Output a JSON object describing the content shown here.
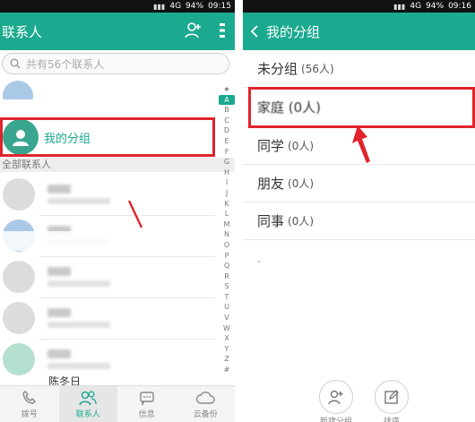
{
  "left": {
    "status": {
      "signal": "4G",
      "battery": "94%",
      "time": "09:15"
    },
    "title": "联系人",
    "search_placeholder": "共有56个联系人",
    "group_row_label": "我的分组",
    "section_label": "全部联系人",
    "alpha": [
      "★",
      "A",
      "B",
      "C",
      "D",
      "E",
      "F",
      "G",
      "H",
      "I",
      "J",
      "K",
      "L",
      "M",
      "N",
      "O",
      "P",
      "Q",
      "R",
      "S",
      "T",
      "U",
      "V",
      "W",
      "X",
      "Y",
      "Z",
      "#"
    ],
    "partial_name": "陈冬日",
    "tabs": [
      "拨号",
      "联系人",
      "信息",
      "云备份"
    ]
  },
  "right": {
    "status": {
      "signal": "4G",
      "battery": "94%",
      "time": "09:16"
    },
    "title": "我的分组",
    "groups": [
      {
        "name": "未分组",
        "count": "(56人)"
      },
      {
        "name": "家庭 (0人)",
        "count": ""
      },
      {
        "name": "同学",
        "count": "(0人)"
      },
      {
        "name": "朋友",
        "count": "(0人)"
      },
      {
        "name": "同事",
        "count": "(0人)"
      }
    ],
    "actions": [
      "新建分组",
      "排序"
    ]
  },
  "colors": {
    "accent": "#1ba98f",
    "highlight": "#e0242b"
  }
}
